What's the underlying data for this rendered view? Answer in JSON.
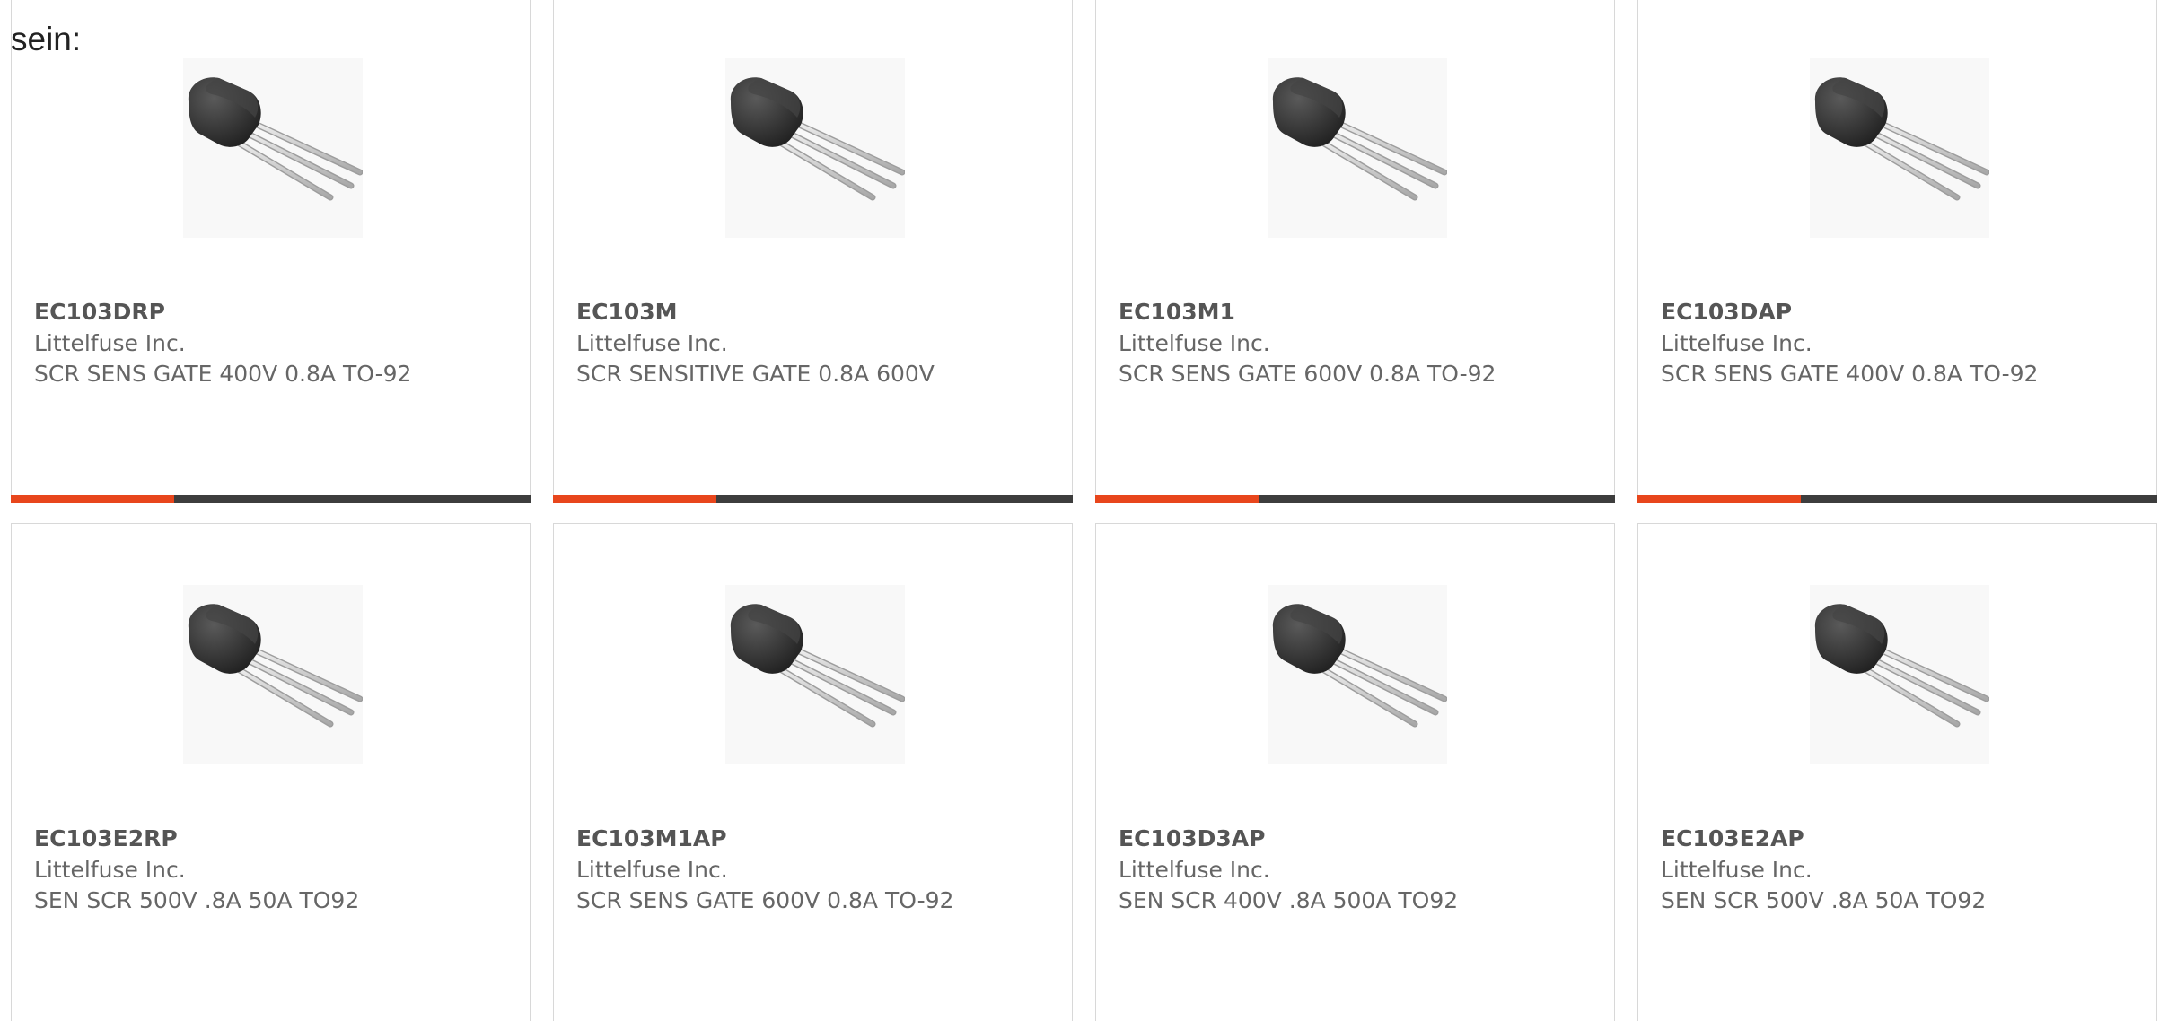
{
  "intro_text": "sein:",
  "colors": {
    "accent": "#e8461c",
    "bar_dark": "#3d3d3d",
    "card_border": "#d8d8d8",
    "text_muted": "#666666"
  },
  "product_image": {
    "icon": "to92-transistor-icon"
  },
  "products": [
    {
      "part_number": "EC103DRP",
      "manufacturer": "Littelfuse Inc.",
      "description": "SCR SENS GATE 400V 0.8A TO-92"
    },
    {
      "part_number": "EC103M",
      "manufacturer": "Littelfuse Inc.",
      "description": "SCR SENSITIVE GATE 0.8A 600V"
    },
    {
      "part_number": "EC103M1",
      "manufacturer": "Littelfuse Inc.",
      "description": "SCR SENS GATE 600V 0.8A TO-92"
    },
    {
      "part_number": "EC103DAP",
      "manufacturer": "Littelfuse Inc.",
      "description": "SCR SENS GATE 400V 0.8A TO-92"
    },
    {
      "part_number": "EC103E2RP",
      "manufacturer": "Littelfuse Inc.",
      "description": "SEN SCR 500V .8A 50A TO92"
    },
    {
      "part_number": "EC103M1AP",
      "manufacturer": "Littelfuse Inc.",
      "description": "SCR SENS GATE 600V 0.8A TO-92"
    },
    {
      "part_number": "EC103D3AP",
      "manufacturer": "Littelfuse Inc.",
      "description": "SEN SCR 400V .8A 500A TO92"
    },
    {
      "part_number": "EC103E2AP",
      "manufacturer": "Littelfuse Inc.",
      "description": "SEN SCR 500V .8A 50A TO92"
    }
  ]
}
